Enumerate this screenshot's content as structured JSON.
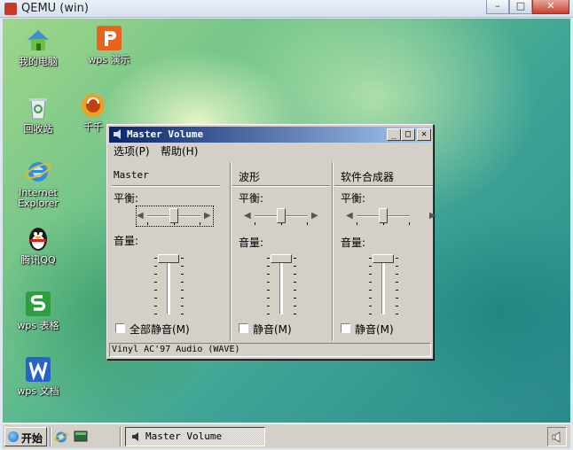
{
  "host": {
    "title": "QEMU (win)",
    "buttons": [
      "–",
      "□",
      "✕"
    ]
  },
  "desktop": {
    "icons": [
      {
        "label": "我的电脑",
        "icon": "computer-icon"
      },
      {
        "label": "wps 演示",
        "icon": "wps-presentation-icon"
      },
      {
        "label": "回收站",
        "icon": "recycle-bin-icon"
      },
      {
        "label": "千千",
        "icon": "ttplayer-icon"
      },
      {
        "label": "Internet Explorer",
        "icon": "internet-explorer-icon"
      },
      {
        "label": "腾讯QQ",
        "icon": "qq-penguin-icon"
      },
      {
        "label": "wps 表格",
        "icon": "wps-spreadsheet-icon"
      },
      {
        "label": "wps 文档",
        "icon": "wps-writer-icon"
      }
    ]
  },
  "mixer": {
    "title": "Master Volume",
    "menu": {
      "options": "选项(P)",
      "help": "帮助(H)"
    },
    "columns": [
      {
        "name": "Master",
        "balance_label": "平衡:",
        "volume_label": "音量:",
        "mute_label": "全部静音(M)",
        "balance": 0.5,
        "volume": 1.0,
        "muted": false
      },
      {
        "name": "波形",
        "balance_label": "平衡:",
        "volume_label": "音量:",
        "mute_label": "静音(M)",
        "balance": 0.5,
        "volume": 1.0,
        "muted": false
      },
      {
        "name": "软件合成器",
        "balance_label": "平衡:",
        "volume_label": "音量:",
        "mute_label": "静音(M)",
        "balance": 0.5,
        "volume": 1.0,
        "muted": false
      }
    ],
    "status": "Vinyl AC'97 Audio (WAVE)"
  },
  "taskbar": {
    "start_label": "开始",
    "task_label": "Master Volume",
    "quicklaunch": [
      "internet-explorer-icon",
      "show-desktop-icon"
    ],
    "tray_icon": "speaker-icon"
  }
}
